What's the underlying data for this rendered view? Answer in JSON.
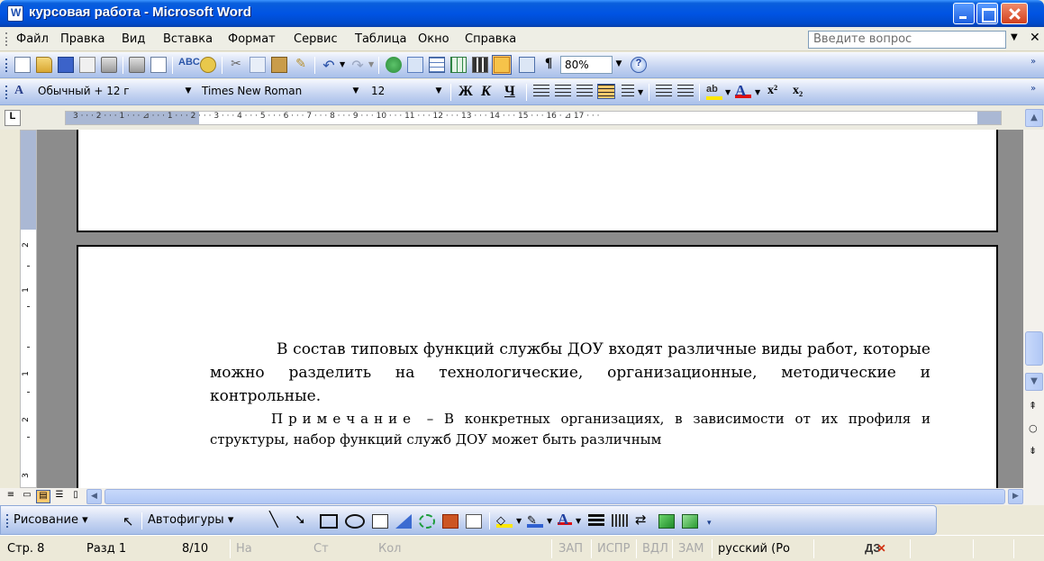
{
  "window": {
    "title": "курсовая работа - Microsoft Word",
    "icon": "word-doc-icon"
  },
  "menu": {
    "items": [
      "Файл",
      "Правка",
      "Вид",
      "Вставка",
      "Формат",
      "Сервис",
      "Таблица",
      "Окно",
      "Справка"
    ],
    "help_placeholder": "Введите вопрос"
  },
  "standard_toolbar": {
    "zoom": "80%"
  },
  "formatting_toolbar": {
    "style": "Обычный + 12 г",
    "font": "Times New Roman",
    "size": "12",
    "bold": "Ж",
    "italic": "К",
    "underline": "Ч",
    "superscript": "x²",
    "subscript": "x₂"
  },
  "ruler": {
    "numbers": "3 · · · 2 · · · 1 · · · ⊿ · · · 1 · · · 2 · · · 3 · · · 4 · · · 5 · · · 6 · · · 7 · · · 8 · · · 9 · · · 10 · · · 11 · · · 12 · · · 13 · · · 14 · · · 15 · · · 16 · ⊿ 17 · · ·",
    "vertical_labels": [
      "2",
      "1",
      "1",
      "2",
      "3"
    ]
  },
  "document": {
    "paragraph1": "В состав типовых функций службы ДОУ входят различные виды работ, которые можно разделить на технологические, организационные, методические и контрольные.",
    "note_word": "Примечание",
    "paragraph2_rest": " – В конкретных организациях, в зависимости от их профиля и структуры, набор функций служб ДОУ может быть различным"
  },
  "drawing_toolbar": {
    "drawing_label": "Рисование",
    "autoshapes_label": "Автофигуры"
  },
  "status": {
    "page": "Стр. 8",
    "section": "Разд 1",
    "pages": "8/10",
    "at": "На",
    "line": "Ст",
    "col": "Кол",
    "rec": "ЗАП",
    "trk": "ИСПР",
    "ext": "ВДЛ",
    "ovr": "ЗАМ",
    "language": "русский (Ро",
    "spell_icon": "ДЗ"
  },
  "colors": {
    "titlebar": "#0054e3",
    "toolbar": "#c4d3f1",
    "active_button": "#ffc96e",
    "document_bg": "#8c8c8c"
  }
}
